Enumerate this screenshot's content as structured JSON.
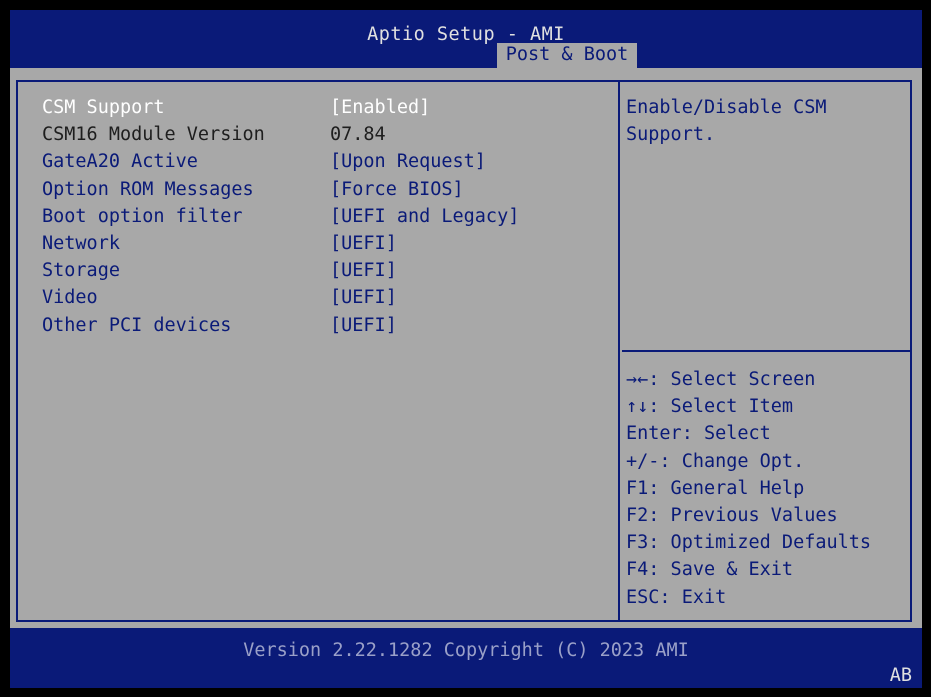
{
  "header": {
    "title": "Aptio Setup - AMI",
    "active_tab": "Post & Boot"
  },
  "settings": [
    {
      "label": "CSM Support",
      "value": "[Enabled]"
    },
    {
      "label": "CSM16 Module Version",
      "value": "07.84"
    },
    {
      "label": "GateA20 Active",
      "value": "[Upon Request]"
    },
    {
      "label": "Option ROM Messages",
      "value": "[Force BIOS]"
    },
    {
      "label": "Boot option filter",
      "value": "[UEFI and Legacy]"
    },
    {
      "label": "Network",
      "value": "[UEFI]"
    },
    {
      "label": "Storage",
      "value": "[UEFI]"
    },
    {
      "label": "Video",
      "value": "[UEFI]"
    },
    {
      "label": "Other PCI devices",
      "value": "[UEFI]"
    }
  ],
  "help_text": "Enable/Disable CSM\nSupport.",
  "key_help": [
    "→←: Select Screen",
    "↑↓: Select Item",
    "Enter: Select",
    "+/-: Change Opt.",
    "F1: General Help",
    "F2: Previous Values",
    "F3: Optimized Defaults",
    "F4: Save & Exit",
    "ESC: Exit"
  ],
  "footer": "Version 2.22.1282 Copyright (C) 2023 AMI",
  "corner_badge": "AB",
  "colors": {
    "header_bg": "#0a1a78",
    "panel_bg": "#a8a8a8",
    "selected_text": "#ffffff",
    "option_text": "#0a1a78",
    "info_text": "#1e1e1e"
  }
}
